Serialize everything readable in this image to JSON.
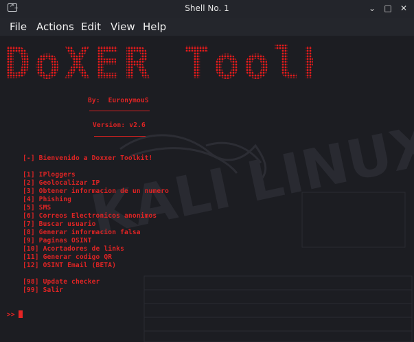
{
  "window": {
    "title": "Shell No. 1",
    "minimize_icon": "⌄",
    "maximize_icon": "□",
    "close_icon": "✕"
  },
  "menu": [
    "File",
    "Actions",
    "Edit",
    "View",
    "Help"
  ],
  "banner": {
    "title": "DoXER ToolKIT",
    "author": "By:  EuronymouS",
    "version": "Version: v2.6"
  },
  "terminal": {
    "welcome": "[-] Bienvenido a Doxxer Toolkit!",
    "options": [
      "[1] IPloggers",
      "[2] Geolocalizar IP",
      "[3] Obtener informacion de un numero",
      "[4] Phishing",
      "[5] SMS",
      "[6] Correos Electronicos anonimos",
      "[7] Buscar usuario",
      "[8] Generar informacion falsa",
      "[9] Paginas OSINT",
      "[10] Acortadores de links",
      "[11] Generar codigo QR",
      "[12] OSINT Email (BETA)"
    ],
    "extra": [
      "[98] Update checker",
      "[99] Salir"
    ],
    "prompt": ">>"
  },
  "colors": {
    "text": "#e02424",
    "background": "#1c1d22",
    "titlebar": "#23252b"
  }
}
